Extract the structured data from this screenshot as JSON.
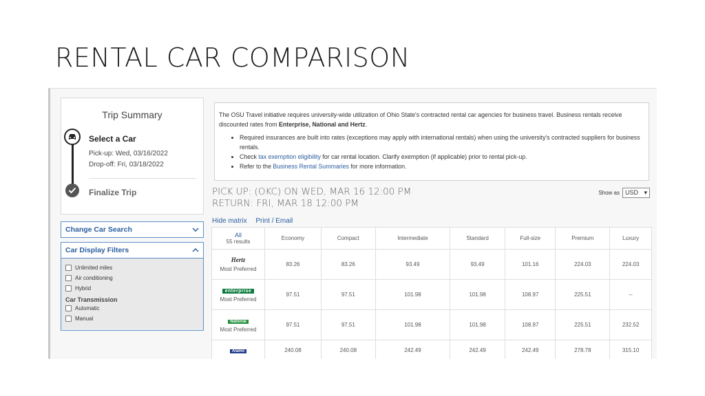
{
  "slide_title": "RENTAL CAR COMPARISON",
  "trip": {
    "title": "Trip Summary",
    "step1": "Select a Car",
    "pickup": "Pick-up: Wed, 03/16/2022",
    "dropoff": "Drop-off: Fri, 03/18/2022",
    "step2": "Finalize Trip"
  },
  "panels": {
    "change_search": "Change Car Search",
    "display_filters": "Car Display Filters",
    "filters": [
      "Unlimited miles",
      "Air conditioning",
      "Hybrid"
    ],
    "transmission_title": "Car Transmission",
    "transmissions": [
      "Automatic",
      "Manual"
    ]
  },
  "notice": {
    "para_a": "The OSU Travel initiative requires university-wide utilization of Ohio State's contracted rental car agencies for business travel. Business rentals receive discounted rates from ",
    "para_bold": "Enterprise, National and Hertz",
    "para_end": ".",
    "bullet1": "Required insurances are built into rates (exceptions may apply with international rentals) when using the university's contracted suppliers for business rentals.",
    "bullet2_pre": "Check ",
    "bullet2_link": "tax exemption eligibility",
    "bullet2_post": " for car rental location. Clarify exemption (if applicable) prior to rental pick-up.",
    "bullet3_pre": "Refer to the ",
    "bullet3_link": "Business Rental Summaries",
    "bullet3_post": " for more information."
  },
  "pickup_line": "PICK UP: (OKC) ON WED, MAR 16 12:00 PM",
  "return_line": "RETURN: FRI, MAR 18 12:00 PM",
  "show_as": {
    "label": "Show as",
    "value": "USD"
  },
  "links": {
    "hide_matrix": "Hide matrix",
    "print_email": "Print / Email"
  },
  "table": {
    "all": "All",
    "results": "55 results",
    "columns": [
      "Economy",
      "Compact",
      "Intermediate",
      "Standard",
      "Full-size",
      "Premium",
      "Luxury"
    ],
    "rows": [
      {
        "vendor": "Hertz",
        "pref": "Most Preferred",
        "values": [
          "83.26",
          "83.26",
          "93.49",
          "93.49",
          "101.16",
          "224.03",
          "224.03"
        ]
      },
      {
        "vendor": "enterprise",
        "pref": "Most Preferred",
        "values": [
          "97.51",
          "97.51",
          "101.98",
          "101.98",
          "108.97",
          "225.51",
          "--"
        ]
      },
      {
        "vendor": "National",
        "pref": "Most Preferred",
        "values": [
          "97.51",
          "97.51",
          "101.98",
          "101.98",
          "108.97",
          "225.51",
          "232.52"
        ]
      },
      {
        "vendor": "Alamo",
        "pref": "",
        "values": [
          "240.08",
          "240.08",
          "242.49",
          "242.49",
          "242.49",
          "278.78",
          "315.10"
        ]
      }
    ]
  },
  "colors": {
    "link": "#2a5d9f",
    "panel_border": "#5b8fc7"
  }
}
